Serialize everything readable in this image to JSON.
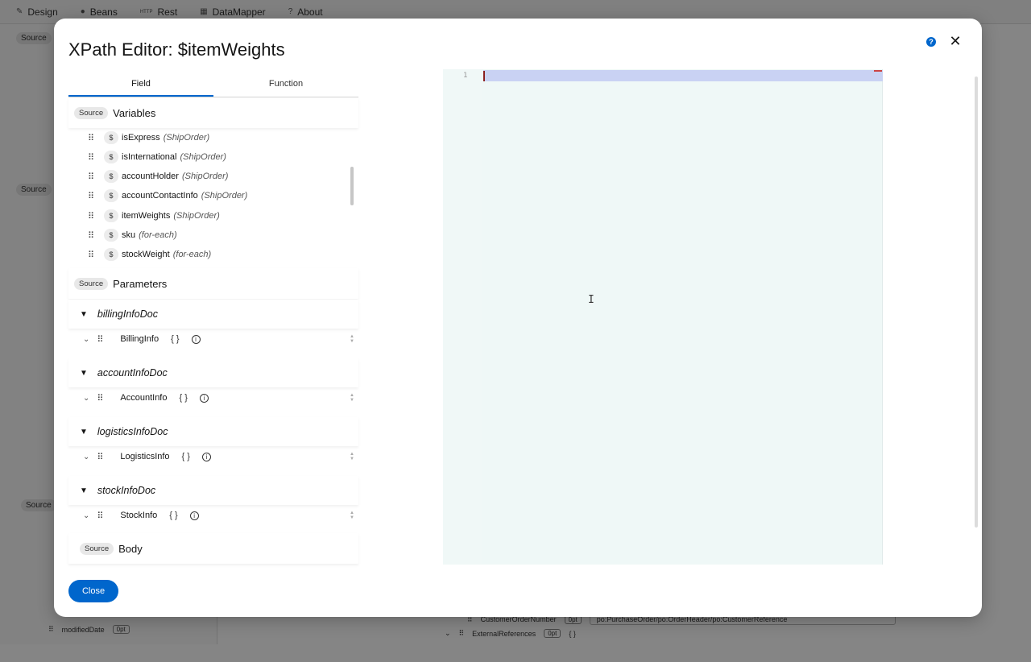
{
  "nav": {
    "items": [
      {
        "label": "Design",
        "icon": "design-icon"
      },
      {
        "label": "Beans",
        "icon": "beans-icon"
      },
      {
        "label": "Rest",
        "icon": "http-icon"
      },
      {
        "label": "DataMapper",
        "icon": "datamapper-icon"
      },
      {
        "label": "About",
        "icon": "question-icon"
      }
    ],
    "http_glyph": "HTTP"
  },
  "background": {
    "source_tag": "Source",
    "row1_name": "CustomerOrderNumber",
    "row1_xpath": "po:PurchaseOrder/po:OrderHeader/po:CustomerReference",
    "row2_name": "ExternalReferences",
    "modified_name": "modifiedDate",
    "opt": "0pt",
    "braces": "{ }"
  },
  "modal": {
    "title": "XPath Editor: $itemWeights",
    "help_glyph": "?",
    "close_glyph": "✕",
    "tabs": [
      {
        "label": "Field",
        "active": true
      },
      {
        "label": "Function",
        "active": false
      }
    ],
    "source_tag": "Source",
    "variables_title": "Variables",
    "parameters_title": "Parameters",
    "body_title": "Body",
    "dollar": "$",
    "variables": [
      {
        "name": "isExpress",
        "scope": "(ShipOrder)"
      },
      {
        "name": "isInternational",
        "scope": "(ShipOrder)"
      },
      {
        "name": "accountHolder",
        "scope": "(ShipOrder)"
      },
      {
        "name": "accountContactInfo",
        "scope": "(ShipOrder)"
      },
      {
        "name": "itemWeights",
        "scope": "(ShipOrder)"
      },
      {
        "name": "sku",
        "scope": "(for-each)"
      },
      {
        "name": "stockWeight",
        "scope": "(for-each)"
      }
    ],
    "parameters": [
      {
        "name": "billingInfoDoc",
        "child": "BillingInfo"
      },
      {
        "name": "accountInfoDoc",
        "child": "AccountInfo"
      },
      {
        "name": "logisticsInfoDoc",
        "child": "LogisticsInfo"
      },
      {
        "name": "stockInfoDoc",
        "child": "StockInfo"
      }
    ],
    "braces": "{ }",
    "info_glyph": "i",
    "editor": {
      "line_number": "1",
      "content": ""
    },
    "close_button": "Close"
  }
}
